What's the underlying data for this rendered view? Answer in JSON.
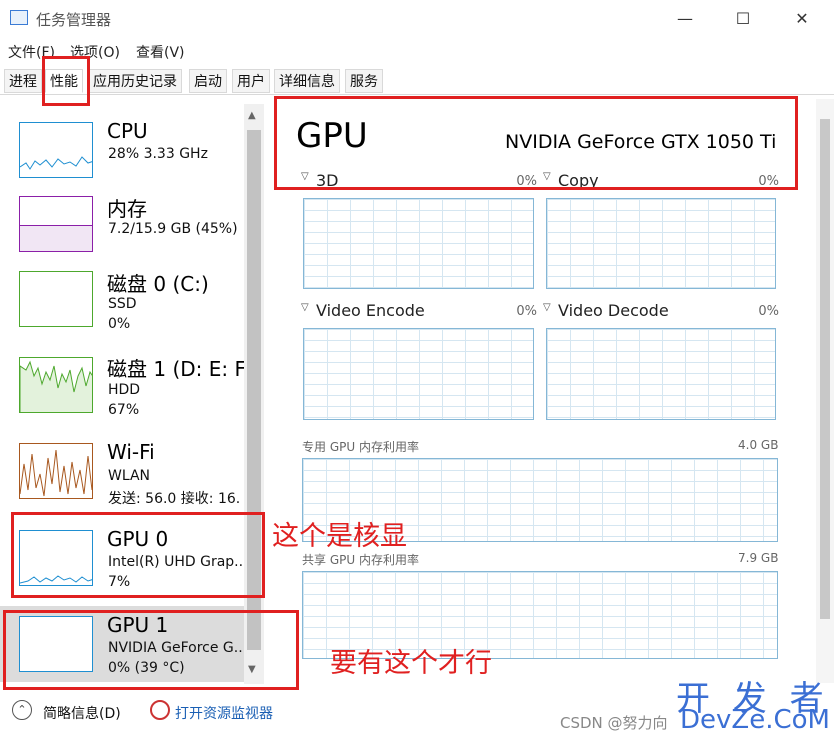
{
  "window": {
    "title": "任务管理器",
    "minimize_glyph": "—",
    "maximize_glyph": "☐",
    "close_glyph": "✕"
  },
  "menu": [
    "文件(F)",
    "选项(O)",
    "查看(V)"
  ],
  "tabs": [
    {
      "label": "进程",
      "active": false
    },
    {
      "label": "性能",
      "active": true
    },
    {
      "label": "应用历史记录",
      "active": false
    },
    {
      "label": "启动",
      "active": false
    },
    {
      "label": "用户",
      "active": false
    },
    {
      "label": "详细信息",
      "active": false
    },
    {
      "label": "服务",
      "active": false
    }
  ],
  "sidebar": {
    "items": [
      {
        "title": "CPU",
        "line1": "28%  3.33 GHz",
        "line2": "",
        "color": "#1f8fd1"
      },
      {
        "title": "内存",
        "line1": "7.2/15.9 GB (45%)",
        "line2": "",
        "color": "#8b1fa8"
      },
      {
        "title": "磁盘 0 (C:)",
        "line1": "SSD",
        "line2": "0%",
        "color": "#4da82d"
      },
      {
        "title": "磁盘 1 (D: E: F:",
        "line1": "HDD",
        "line2": "67%",
        "color": "#4da82d"
      },
      {
        "title": "Wi-Fi",
        "line1": "WLAN",
        "line2": "发送: 56.0  接收: 16.",
        "color": "#a8581f"
      },
      {
        "title": "GPU 0",
        "line1": "Intel(R) UHD Grap...",
        "line2": "7%",
        "color": "#1f8fd1"
      },
      {
        "title": "GPU 1",
        "line1": "NVIDIA GeForce G...",
        "line2": "0% (39 °C)",
        "color": "#1f8fd1",
        "selected": true
      }
    ]
  },
  "main": {
    "heading": "GPU",
    "model": "NVIDIA GeForce GTX 1050 Ti",
    "engines": [
      {
        "label": "3D",
        "pct": "0%"
      },
      {
        "label": "Copy",
        "pct": "0%"
      },
      {
        "label": "Video Encode",
        "pct": "0%"
      },
      {
        "label": "Video Decode",
        "pct": "0%"
      }
    ],
    "dedicated_mem": {
      "label": "专用 GPU 内存利用率",
      "max": "4.0 GB"
    },
    "shared_mem": {
      "label": "共享 GPU 内存利用率",
      "max": "7.9 GB"
    }
  },
  "footer": {
    "collapse_glyph": "⌃",
    "summary": "简略信息(D)",
    "resmon": "打开资源监视器"
  },
  "annotations": {
    "core_gpu_note": "这个是核显",
    "need_this_note": "要有这个才行",
    "color": "#e02020"
  },
  "watermark": {
    "big": "开 发 者",
    "site": "DevZe.CoM",
    "csdn": "CSDN @努力向"
  }
}
